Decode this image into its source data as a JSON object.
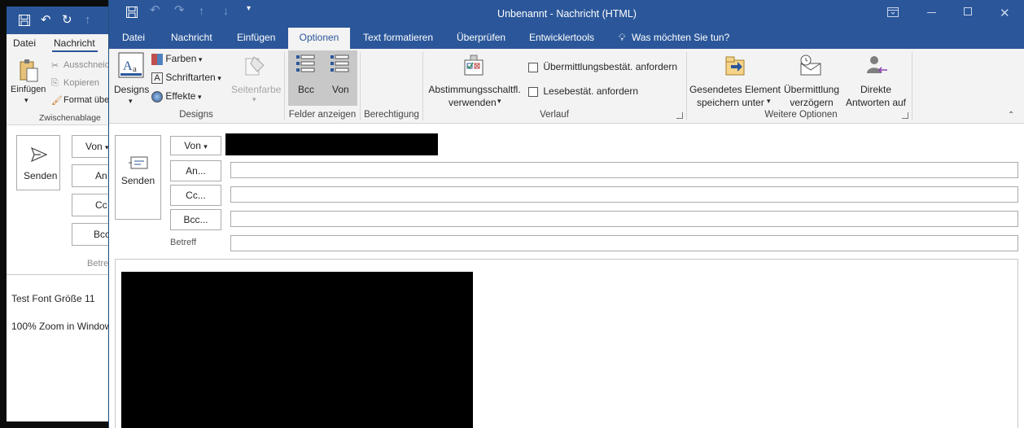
{
  "back_window": {
    "tabs": [
      "Datei",
      "Nachricht"
    ],
    "clipboard": {
      "paste_label": "Einfügen",
      "cut_label": "Ausschneid",
      "copy_label": "Kopieren",
      "format_label": "Format übe",
      "group_label": "Zwischenablage"
    },
    "send_label": "Senden",
    "from_label": "Von",
    "to_label": "An",
    "cc_label": "Cc",
    "bcc_label": "Bcc",
    "subject_label": "Betref",
    "body_lines": [
      "Test Font Größe 11",
      "100% Zoom in Window"
    ]
  },
  "window": {
    "title": "Unbenannt - Nachricht (HTML)",
    "colors": {
      "accent": "#2b579a",
      "ribbon_bg": "#f3f3f3"
    }
  },
  "tabs": [
    "Datei",
    "Nachricht",
    "Einfügen",
    "Optionen",
    "Text formatieren",
    "Überprüfen",
    "Entwicklertools"
  ],
  "active_tab": "Optionen",
  "tell_me": "Was möchten Sie tun?",
  "ribbon": {
    "designs": {
      "designs_label": "Designs",
      "farben": "Farben",
      "schriftarten": "Schriftarten",
      "effekte": "Effekte",
      "seitenfarbe": "Seitenfarbe",
      "group_label": "Designs"
    },
    "felder": {
      "bcc": "Bcc",
      "von": "Von",
      "group_label": "Felder anzeigen"
    },
    "berechtigung": {
      "group_label": "Berechtigung"
    },
    "verlauf": {
      "abst_line1": "Abstimmungsschaltfl.",
      "abst_line2": "verwenden",
      "uebermittlung_check": "Übermittlungsbestät. anfordern",
      "lese_check": "Lesebestät. anfordern",
      "group_label": "Verlauf"
    },
    "weitere": {
      "gesendet_line1": "Gesendetes Element",
      "gesendet_line2": "speichern unter",
      "verz_line1": "Übermittlung",
      "verz_line2": "verzögern",
      "direkt_line1": "Direkte",
      "direkt_line2": "Antworten auf",
      "group_label": "Weitere Optionen"
    }
  },
  "compose": {
    "send_label": "Senden",
    "from_button": "Von",
    "to_button": "An...",
    "cc_button": "Cc...",
    "bcc_button": "Bcc...",
    "subject_label": "Betreff",
    "to_value": "",
    "cc_value": "",
    "bcc_value": "",
    "subject_value": ""
  }
}
